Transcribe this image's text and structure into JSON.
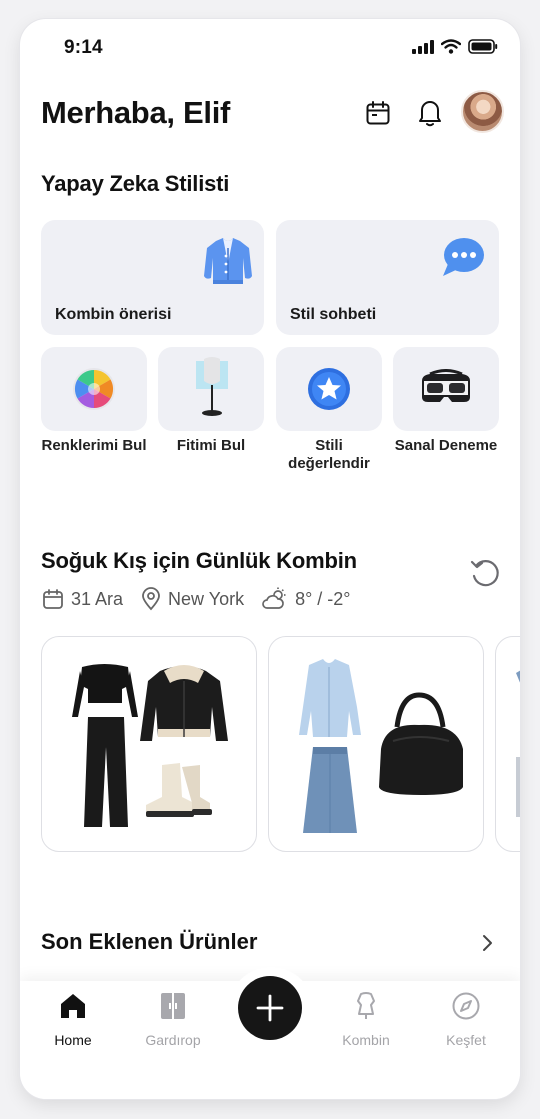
{
  "status_bar": {
    "time": "9:14"
  },
  "header": {
    "greeting": "Merhaba, Elif"
  },
  "ai_stylist": {
    "title": "Yapay Zeka Stilisti",
    "cards": [
      {
        "label": "Kombin önerisi",
        "icon": "cardigan-icon"
      },
      {
        "label": "Stil sohbeti",
        "icon": "chat-bubble-icon"
      }
    ],
    "tools": [
      {
        "label": "Renklerimi Bul",
        "icon": "color-wheel-icon"
      },
      {
        "label": "Fitimi Bul",
        "icon": "mannequin-icon"
      },
      {
        "label_line1": "Stili",
        "label_line2": "değerlendir",
        "icon": "star-badge-icon"
      },
      {
        "label": "Sanal Deneme",
        "icon": "vr-headset-icon"
      }
    ]
  },
  "daily_outfit": {
    "title": "Soğuk Kış için Günlük Kombin",
    "date": "31 Ara",
    "location": "New York",
    "weather": "8° / -2°"
  },
  "recent_products": {
    "title": "Son Eklenen Ürünler"
  },
  "bottom_nav": {
    "items": [
      {
        "label": "Home",
        "icon": "home-icon",
        "active": true
      },
      {
        "label": "Gardırop",
        "icon": "wardrobe-icon",
        "active": false
      },
      {
        "label": "Kombin",
        "icon": "dress-form-icon",
        "active": false
      },
      {
        "label": "Keşfet",
        "icon": "compass-icon",
        "active": false
      }
    ],
    "add_icon": "plus-icon"
  },
  "colors": {
    "card_bg": "#eff0f5",
    "accent_blue": "#3b82f6",
    "text_dark": "#111111",
    "nav_inactive": "#a4a4a8"
  }
}
